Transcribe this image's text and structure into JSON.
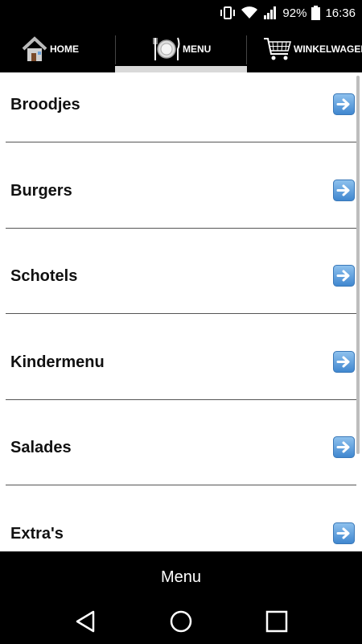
{
  "status_bar": {
    "battery_percent": "92%",
    "time": "16:36",
    "icons": [
      "vibrate-icon",
      "wifi-icon",
      "signal-icon",
      "battery-icon"
    ]
  },
  "tabs": [
    {
      "label": "HOME",
      "icon": "house-icon",
      "active": false
    },
    {
      "label": "MENU",
      "icon": "plate-cutlery-icon",
      "active": true
    },
    {
      "label": "WINKELWAGEN",
      "icon": "shopping-cart-icon",
      "active": false
    }
  ],
  "menu": {
    "items": [
      {
        "label": "Broodjes",
        "icon": "arrow-right-icon"
      },
      {
        "label": "Burgers",
        "icon": "arrow-right-icon"
      },
      {
        "label": "Schotels",
        "icon": "arrow-right-icon"
      },
      {
        "label": "Kindermenu",
        "icon": "arrow-right-icon"
      },
      {
        "label": "Salades",
        "icon": "arrow-right-icon"
      },
      {
        "label": "Extra's",
        "icon": "arrow-right-icon"
      }
    ]
  },
  "footer": {
    "title": "Menu"
  },
  "colors": {
    "accent_arrow": "#4a90d9",
    "background": "#000000",
    "content": "#ffffff"
  }
}
